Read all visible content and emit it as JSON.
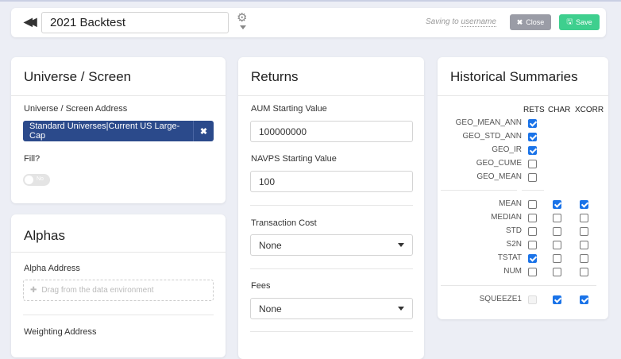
{
  "header": {
    "back_icon": "double-chevron-left-icon",
    "title_value": "2021 Backtest",
    "settings_icon": "gear-icon",
    "saving_prefix": "Saving to",
    "saving_user": "username",
    "close_label": "Close",
    "save_label": "Save",
    "close_color": "#9a9ca6",
    "save_color": "#3ecf8e"
  },
  "universe": {
    "title": "Universe / Screen",
    "address_label": "Universe / Screen Address",
    "address_value": "Standard Universes|Current US Large-Cap",
    "address_color": "#2b4a8b",
    "fill_label": "Fill?",
    "fill_toggle": "No",
    "fill_on": false
  },
  "alphas": {
    "title": "Alphas",
    "alpha_address_label": "Alpha Address",
    "alpha_placeholder": "Drag from the data environment",
    "weighting_label": "Weighting Address"
  },
  "returns": {
    "title": "Returns",
    "aum_label": "AUM Starting Value",
    "aum_value": "100000000",
    "navps_label": "NAVPS Starting Value",
    "navps_value": "100",
    "tc_label": "Transaction Cost",
    "tc_value": "None",
    "fees_label": "Fees",
    "fees_value": "None"
  },
  "historical": {
    "title": "Historical Summaries",
    "columns": [
      "RETS",
      "CHAR",
      "XCORR"
    ],
    "group1": [
      {
        "label": "GEO_MEAN_ANN",
        "rets": true
      },
      {
        "label": "GEO_STD_ANN",
        "rets": true
      },
      {
        "label": "GEO_IR",
        "rets": true
      },
      {
        "label": "GEO_CUME",
        "rets": false
      },
      {
        "label": "GEO_MEAN",
        "rets": false
      }
    ],
    "group2": [
      {
        "label": "MEAN",
        "values": [
          false,
          true,
          true
        ]
      },
      {
        "label": "MEDIAN",
        "values": [
          false,
          false,
          false
        ]
      },
      {
        "label": "STD",
        "values": [
          false,
          false,
          false
        ]
      },
      {
        "label": "S2N",
        "values": [
          false,
          false,
          false
        ]
      },
      {
        "label": "TSTAT",
        "values": [
          true,
          false,
          false
        ]
      },
      {
        "label": "NUM",
        "values": [
          false,
          false,
          false
        ]
      }
    ],
    "group3": [
      {
        "label": "SQUEEZE1",
        "values": [
          null,
          true,
          true
        ]
      }
    ],
    "check_color": "#1a73e8"
  }
}
